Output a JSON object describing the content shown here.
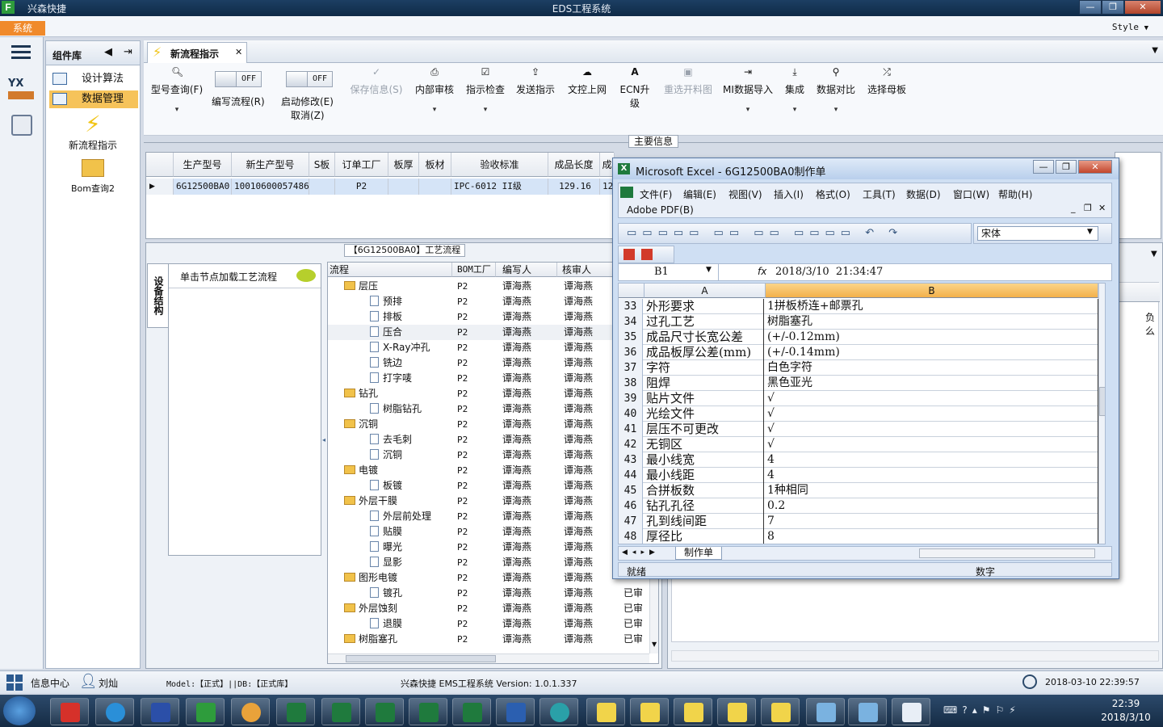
{
  "window": {
    "app_name": "兴森快捷",
    "title": "EDS工程系统",
    "style_label": "Style"
  },
  "sysbar": {
    "system_button": "系统"
  },
  "components": {
    "header": "组件库",
    "items": [
      {
        "label": "设计算法"
      },
      {
        "label": "数据管理"
      }
    ],
    "launchers": [
      {
        "label": "新流程指示"
      },
      {
        "label": "Bom查询2"
      }
    ]
  },
  "tab": {
    "label": "新流程指示"
  },
  "toolbar": {
    "buttons": [
      {
        "label": "型号查询(F)",
        "icon": "search-icon"
      },
      {
        "label": "编写流程(R)"
      },
      {
        "label": "启动修改(E)",
        "sub": "取消(Z)"
      },
      {
        "label": "保存信息(S)",
        "icon": "check-icon"
      },
      {
        "label": "内部审核",
        "icon": "print-icon"
      },
      {
        "label": "指示检查",
        "icon": "check-box-icon"
      },
      {
        "label": "发送指示",
        "icon": "upload-icon"
      },
      {
        "label": "文控上网",
        "icon": "cloud-upload-icon"
      },
      {
        "label": "ECN升级",
        "icon": "ecn-icon"
      },
      {
        "label": "重选开料图",
        "icon": "image-icon"
      },
      {
        "label": "MI数据导入",
        "icon": "import-icon"
      },
      {
        "label": "集成",
        "icon": "download-icon"
      },
      {
        "label": "数据对比",
        "icon": "compare-icon"
      },
      {
        "label": "选择母板",
        "icon": "shuffle-icon"
      }
    ],
    "toggle_off": "OFF"
  },
  "main_info": {
    "title": "主要信息",
    "columns": [
      "生产型号",
      "新生产型号",
      "S板",
      "订单工厂",
      "板厚",
      "板材",
      "验收标准",
      "成品长度",
      "成"
    ],
    "row": [
      "6G12500BA0",
      "10010600057486",
      "",
      "P2",
      "",
      "",
      "IPC-6012 II级",
      "129.16",
      "12"
    ]
  },
  "process": {
    "title": "【6G12500BA0】工艺流程",
    "side_tab": "设备结构",
    "hint": "单击节点加载工艺流程",
    "columns": [
      "流程",
      "BOM工厂",
      "编写人",
      "核审人"
    ],
    "rows": [
      {
        "level": 1,
        "name": "层压",
        "bom": "P2",
        "writer": "谭海燕",
        "reviewer": "谭海燕"
      },
      {
        "level": 2,
        "name": "预排",
        "bom": "P2",
        "writer": "谭海燕",
        "reviewer": "谭海燕"
      },
      {
        "level": 2,
        "name": "排板",
        "bom": "P2",
        "writer": "谭海燕",
        "reviewer": "谭海燕"
      },
      {
        "level": 2,
        "name": "压合",
        "bom": "P2",
        "writer": "谭海燕",
        "reviewer": "谭海燕"
      },
      {
        "level": 2,
        "name": "X-Ray冲孔",
        "bom": "P2",
        "writer": "谭海燕",
        "reviewer": "谭海燕"
      },
      {
        "level": 2,
        "name": "铣边",
        "bom": "P2",
        "writer": "谭海燕",
        "reviewer": "谭海燕"
      },
      {
        "level": 2,
        "name": "打字唛",
        "bom": "P2",
        "writer": "谭海燕",
        "reviewer": "谭海燕"
      },
      {
        "level": 1,
        "name": "钻孔",
        "bom": "P2",
        "writer": "谭海燕",
        "reviewer": "谭海燕"
      },
      {
        "level": 2,
        "name": "树脂钻孔",
        "bom": "P2",
        "writer": "谭海燕",
        "reviewer": "谭海燕"
      },
      {
        "level": 1,
        "name": "沉铜",
        "bom": "P2",
        "writer": "谭海燕",
        "reviewer": "谭海燕"
      },
      {
        "level": 2,
        "name": "去毛刺",
        "bom": "P2",
        "writer": "谭海燕",
        "reviewer": "谭海燕"
      },
      {
        "level": 2,
        "name": "沉铜",
        "bom": "P2",
        "writer": "谭海燕",
        "reviewer": "谭海燕"
      },
      {
        "level": 1,
        "name": "电镀",
        "bom": "P2",
        "writer": "谭海燕",
        "reviewer": "谭海燕"
      },
      {
        "level": 2,
        "name": "板镀",
        "bom": "P2",
        "writer": "谭海燕",
        "reviewer": "谭海燕"
      },
      {
        "level": 1,
        "name": "外层干膜",
        "bom": "P2",
        "writer": "谭海燕",
        "reviewer": "谭海燕"
      },
      {
        "level": 2,
        "name": "外层前处理",
        "bom": "P2",
        "writer": "谭海燕",
        "reviewer": "谭海燕"
      },
      {
        "level": 2,
        "name": "贴膜",
        "bom": "P2",
        "writer": "谭海燕",
        "reviewer": "谭海燕"
      },
      {
        "level": 2,
        "name": "曝光",
        "bom": "P2",
        "writer": "谭海燕",
        "reviewer": "谭海燕"
      },
      {
        "level": 2,
        "name": "显影",
        "bom": "P2",
        "writer": "谭海燕",
        "reviewer": "谭海燕"
      },
      {
        "level": 1,
        "name": "图形电镀",
        "bom": "P2",
        "writer": "谭海燕",
        "reviewer": "谭海燕"
      },
      {
        "level": 2,
        "name": "镀孔",
        "bom": "P2",
        "writer": "谭海燕",
        "reviewer": "谭海燕",
        "status": "已审"
      },
      {
        "level": 1,
        "name": "外层蚀刻",
        "bom": "P2",
        "writer": "谭海燕",
        "reviewer": "谭海燕",
        "status": "已审"
      },
      {
        "level": 2,
        "name": "退膜",
        "bom": "P2",
        "writer": "谭海燕",
        "reviewer": "谭海燕",
        "status": "已审"
      },
      {
        "level": 1,
        "name": "树脂塞孔",
        "bom": "P2",
        "writer": "谭海燕",
        "reviewer": "谭海燕",
        "status": "已审"
      }
    ]
  },
  "right_panel": {
    "partial_header": "负么"
  },
  "excel": {
    "title": "Microsoft Excel - 6G12500BA0制作单",
    "menus": [
      "文件(F)",
      "编辑(E)",
      "视图(V)",
      "插入(I)",
      "格式(O)",
      "工具(T)",
      "数据(D)",
      "窗口(W)",
      "帮助(H)"
    ],
    "menu2": "Adobe PDF(B)",
    "font_name": "宋体",
    "cell_ref": "B1",
    "formula": "2018/3/10  21:34:47",
    "col_a": "A",
    "col_b": "B",
    "rows": [
      {
        "n": "33",
        "a": "外形要求",
        "b": "1拼板桥连+邮票孔"
      },
      {
        "n": "34",
        "a": "过孔工艺",
        "b": "树脂塞孔"
      },
      {
        "n": "35",
        "a": "成品尺寸长宽公差",
        "b": "(+/-0.12mm)"
      },
      {
        "n": "36",
        "a": "成品板厚公差(mm)",
        "b": "(+/-0.14mm)"
      },
      {
        "n": "37",
        "a": "字符",
        "b": "白色字符"
      },
      {
        "n": "38",
        "a": "阻焊",
        "b": "黑色亚光"
      },
      {
        "n": "39",
        "a": "贴片文件",
        "b": "√"
      },
      {
        "n": "40",
        "a": "光绘文件",
        "b": "√"
      },
      {
        "n": "41",
        "a": "层压不可更改",
        "b": "√"
      },
      {
        "n": "42",
        "a": "无铜区",
        "b": "√"
      },
      {
        "n": "43",
        "a": "最小线宽",
        "b": "4"
      },
      {
        "n": "44",
        "a": "最小线距",
        "b": "4"
      },
      {
        "n": "45",
        "a": "合拼板数",
        "b": "1种相同"
      },
      {
        "n": "46",
        "a": "钻孔孔径",
        "b": "0.2"
      },
      {
        "n": "47",
        "a": "孔到线间距",
        "b": "7"
      },
      {
        "n": "48",
        "a": "厚径比",
        "b": "8"
      }
    ],
    "sheet_tab": "制作单",
    "status_ready": "就绪",
    "status_num": "数字"
  },
  "statusbar": {
    "info_center": "信息中心",
    "user": "刘灿",
    "model": "Model:【正式】||DB:【正式库】",
    "system": "兴森快捷 EMS工程系统 Version: 1.0.1.337",
    "datetime": "2018-03-10 22:39:57"
  },
  "taskbar": {
    "time": "22:39",
    "date": "2018/3/10"
  },
  "colors": {
    "accent": "#f08a2b",
    "selected": "#f6c35a",
    "excel_header_sel": "#f3b04a",
    "taskbar": "#1d3653"
  }
}
